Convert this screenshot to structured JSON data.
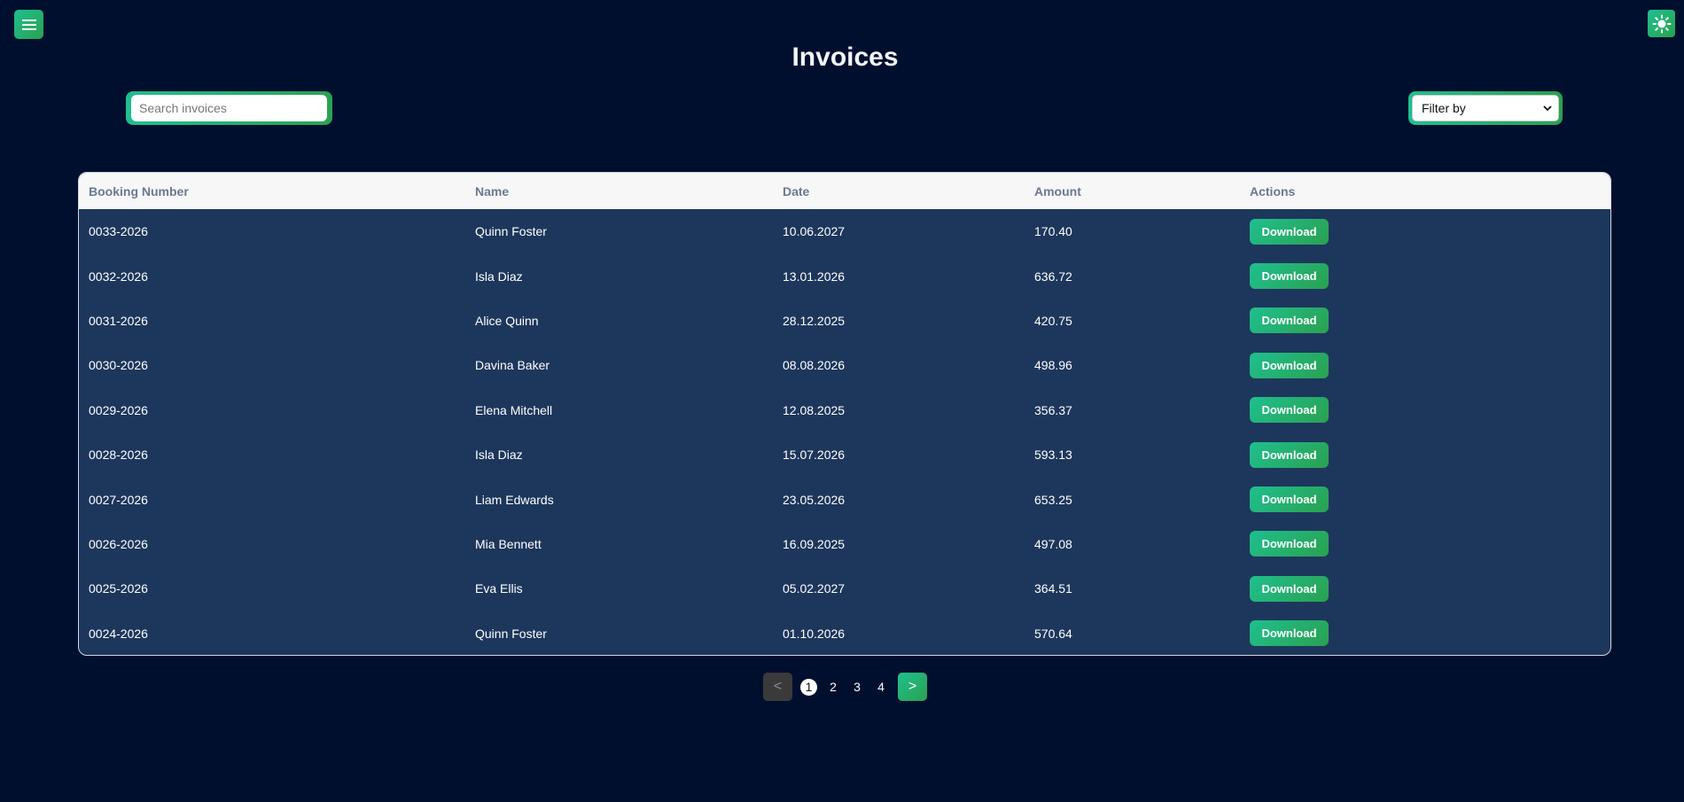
{
  "header": {
    "menu_icon": "hamburger-menu-icon",
    "theme_icon": "sun-icon",
    "title": "Invoices"
  },
  "search": {
    "placeholder": "Search invoices",
    "value": ""
  },
  "filter": {
    "selected": "Filter by"
  },
  "table": {
    "columns": [
      "Booking Number",
      "Name",
      "Date",
      "Amount",
      "Actions"
    ],
    "rows": [
      {
        "booking": "0033-2026",
        "name": "Quinn Foster",
        "date": "10.06.2027",
        "amount": "170.40",
        "action": "Download"
      },
      {
        "booking": "0032-2026",
        "name": "Isla Diaz",
        "date": "13.01.2026",
        "amount": "636.72",
        "action": "Download"
      },
      {
        "booking": "0031-2026",
        "name": "Alice Quinn",
        "date": "28.12.2025",
        "amount": "420.75",
        "action": "Download"
      },
      {
        "booking": "0030-2026",
        "name": "Davina Baker",
        "date": "08.08.2026",
        "amount": "498.96",
        "action": "Download"
      },
      {
        "booking": "0029-2026",
        "name": "Elena Mitchell",
        "date": "12.08.2025",
        "amount": "356.37",
        "action": "Download"
      },
      {
        "booking": "0028-2026",
        "name": "Isla Diaz",
        "date": "15.07.2026",
        "amount": "593.13",
        "action": "Download"
      },
      {
        "booking": "0027-2026",
        "name": "Liam Edwards",
        "date": "23.05.2026",
        "amount": "653.25",
        "action": "Download"
      },
      {
        "booking": "0026-2026",
        "name": "Mia Bennett",
        "date": "16.09.2025",
        "amount": "497.08",
        "action": "Download"
      },
      {
        "booking": "0025-2026",
        "name": "Eva Ellis",
        "date": "05.02.2027",
        "amount": "364.51",
        "action": "Download"
      },
      {
        "booking": "0024-2026",
        "name": "Quinn Foster",
        "date": "01.10.2026",
        "amount": "570.64",
        "action": "Download"
      }
    ]
  },
  "pagination": {
    "prev_label": "<",
    "next_label": ">",
    "pages": [
      "1",
      "2",
      "3",
      "4"
    ],
    "current": "1"
  },
  "colors": {
    "background": "#010f2e",
    "table_body": "#1d375c",
    "accent_start": "#1fbf8f",
    "accent_end": "#2aa150"
  }
}
